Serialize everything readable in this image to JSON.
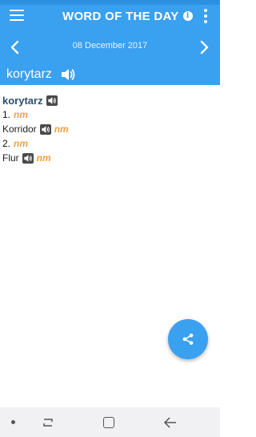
{
  "app": {
    "title": "WORD OF THE DAY",
    "date": "08 December 2017",
    "word": "korytarz"
  },
  "entry": {
    "headword": "korytarz",
    "senses": [
      {
        "number": "1.",
        "pos": "nm",
        "translation": "Korridor",
        "translation_pos": "nm"
      },
      {
        "number": "2.",
        "pos": "nm",
        "translation": "Flur",
        "translation_pos": "nm"
      }
    ]
  },
  "icons": {
    "menu": "hamburger-menu-icon",
    "info": "info-icon",
    "more": "more-vertical-icon",
    "prev": "chevron-left-icon",
    "next": "chevron-right-icon",
    "speaker": "speaker-icon",
    "share": "share-icon"
  },
  "colors": {
    "app_bar": "#3aa0f0",
    "headword": "#2b4f73",
    "part_of_speech": "#f0a040",
    "fab": "#3aa0f0"
  }
}
